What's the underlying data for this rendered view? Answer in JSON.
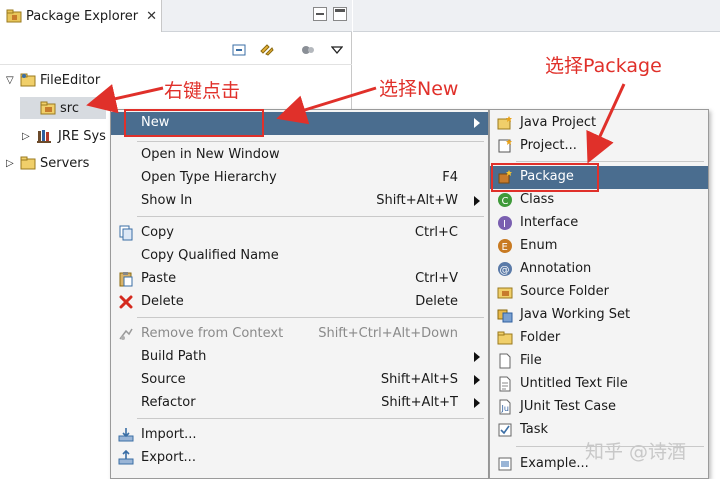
{
  "package_explorer": {
    "tab_title": "Package Explorer",
    "close_glyph": "✕",
    "tree": [
      {
        "label": "FileEditor",
        "twisty": "▽"
      },
      {
        "label": "src"
      },
      {
        "label": "JRE Sys",
        "twisty": "▷"
      },
      {
        "label": "Servers",
        "twisty": "▷"
      }
    ]
  },
  "context_menu": {
    "items": [
      {
        "label": "New",
        "submenu": true
      },
      {
        "label": "Open in New Window"
      },
      {
        "label": "Open Type Hierarchy",
        "shortcut": "F4"
      },
      {
        "label": "Show In",
        "shortcut": "Shift+Alt+W",
        "submenu": true
      },
      {
        "label": "Copy",
        "shortcut": "Ctrl+C"
      },
      {
        "label": "Copy Qualified Name"
      },
      {
        "label": "Paste",
        "shortcut": "Ctrl+V"
      },
      {
        "label": "Delete",
        "shortcut": "Delete"
      },
      {
        "label": "Remove from Context",
        "shortcut": "Shift+Ctrl+Alt+Down",
        "disabled": true
      },
      {
        "label": "Build Path",
        "submenu": true
      },
      {
        "label": "Source",
        "shortcut": "Shift+Alt+S",
        "submenu": true
      },
      {
        "label": "Refactor",
        "shortcut": "Shift+Alt+T",
        "submenu": true
      },
      {
        "label": "Import..."
      },
      {
        "label": "Export..."
      }
    ]
  },
  "submenu_new": {
    "items": [
      {
        "label": "Java Project"
      },
      {
        "label": "Project..."
      },
      {
        "label": "Package"
      },
      {
        "label": "Class"
      },
      {
        "label": "Interface"
      },
      {
        "label": "Enum"
      },
      {
        "label": "Annotation"
      },
      {
        "label": "Source Folder"
      },
      {
        "label": "Java Working Set"
      },
      {
        "label": "Folder"
      },
      {
        "label": "File"
      },
      {
        "label": "Untitled Text File"
      },
      {
        "label": "JUnit Test Case"
      },
      {
        "label": "Task"
      },
      {
        "label": "Example..."
      }
    ]
  },
  "annotations": {
    "right_click": "右键点击",
    "select_new": "选择New",
    "select_package": "选择Package",
    "color": "#e0302a"
  },
  "watermark": "知乎 @诗酒",
  "colors": {
    "selection": "#4a6d8f",
    "menu_bg": "#f4f4f4"
  }
}
